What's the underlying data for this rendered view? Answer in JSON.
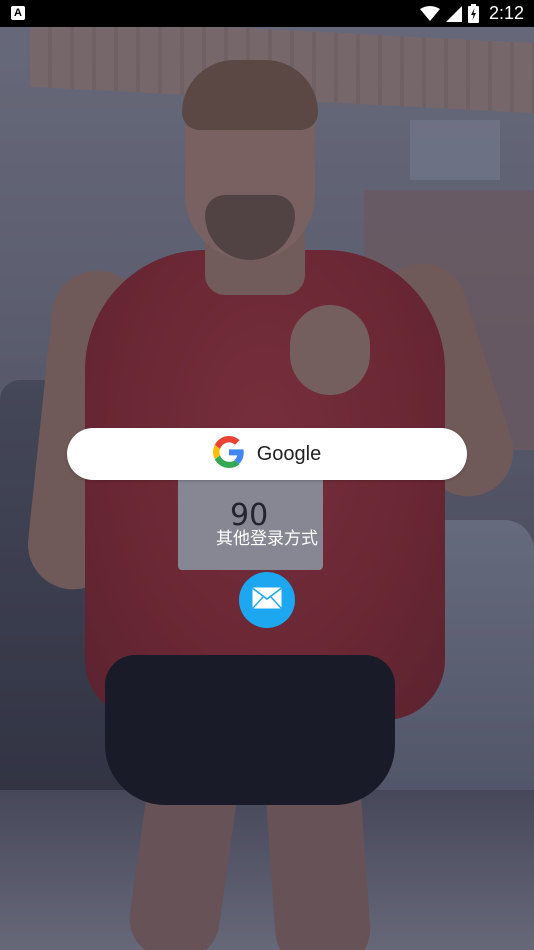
{
  "status_bar": {
    "time": "2:12",
    "left_icon_letter": "A",
    "icons": [
      "wifi-icon",
      "signal-icon",
      "battery-charging-icon"
    ]
  },
  "background": {
    "bib_number": "90"
  },
  "login": {
    "google_label": "Google",
    "google_icon": "google-g-icon",
    "other_methods_label": "其他登录方式",
    "email_icon": "mail-icon"
  },
  "colors": {
    "status_bar_bg": "#000000",
    "email_button_bg": "#1da7f0",
    "google_button_bg": "#ffffff"
  }
}
